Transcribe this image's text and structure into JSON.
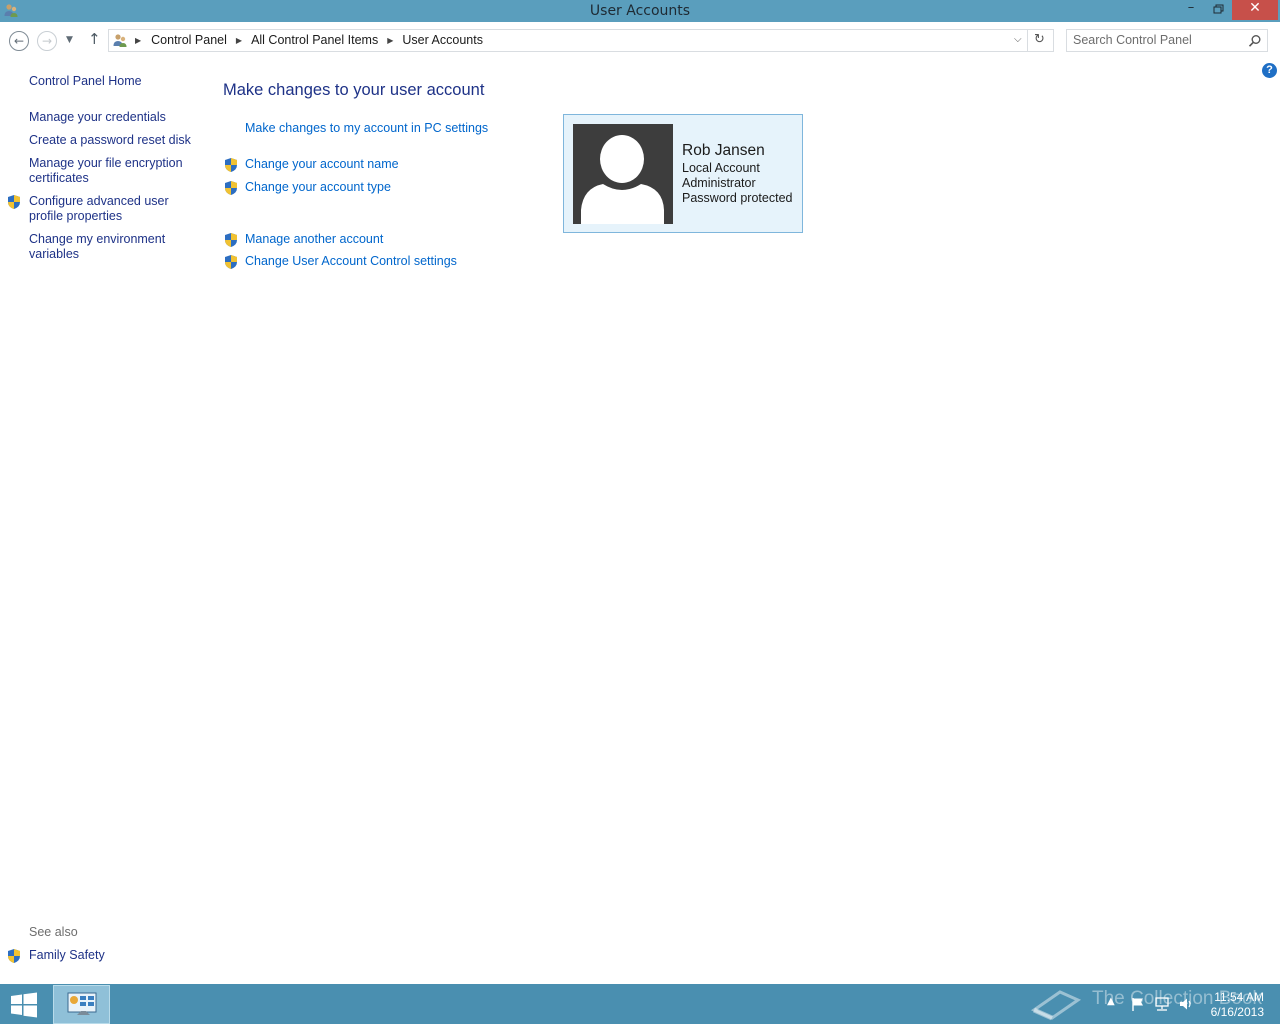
{
  "window": {
    "title": "User Accounts",
    "icon": "users-icon",
    "buttons": {
      "minimize": "minimize-icon",
      "maximize": "restore-icon",
      "close": "close-icon"
    }
  },
  "nav": {
    "back_icon": "back-arrow-icon",
    "forward_icon": "forward-arrow-icon",
    "recent_icon": "chevron-down-icon",
    "up_icon": "up-arrow-icon"
  },
  "breadcrumb": {
    "items": [
      "Control Panel",
      "All Control Panel Items",
      "User Accounts"
    ]
  },
  "search": {
    "placeholder": "Search Control Panel"
  },
  "sidebar": {
    "home": "Control Panel Home",
    "items": [
      {
        "label": "Manage your credentials",
        "shield": false
      },
      {
        "label": "Create a password reset disk",
        "shield": false
      },
      {
        "label": "Manage your file encryption certificates",
        "shield": false
      },
      {
        "label": "Configure advanced user profile properties",
        "shield": true
      },
      {
        "label": "Change my environment variables",
        "shield": false
      }
    ],
    "see_also_label": "See also",
    "see_also_items": [
      {
        "label": "Family Safety",
        "shield": true
      }
    ]
  },
  "main": {
    "heading": "Make changes to your user account",
    "links": [
      {
        "label": "Make changes to my account in PC settings",
        "shield": false
      },
      {
        "label": "Change your account name",
        "shield": true
      },
      {
        "label": "Change your account type",
        "shield": true
      },
      {
        "label": "Manage another account",
        "shield": true
      },
      {
        "label": "Change User Account Control settings",
        "shield": true
      }
    ]
  },
  "account": {
    "name": "Rob Jansen",
    "type": "Local Account",
    "role": "Administrator",
    "status": "Password protected"
  },
  "taskbar": {
    "clock_time": "11:54 AM",
    "clock_date": "6/16/2013",
    "watermark": "The Collection Book"
  },
  "colors": {
    "titlebar": "#5a9ebd",
    "taskbar": "#4a8fb0",
    "link": "#0066cc",
    "heading": "#1e3287",
    "tile_bg": "#e6f3fb",
    "tile_border": "#7fb6dc",
    "close_button": "#c7504a"
  }
}
